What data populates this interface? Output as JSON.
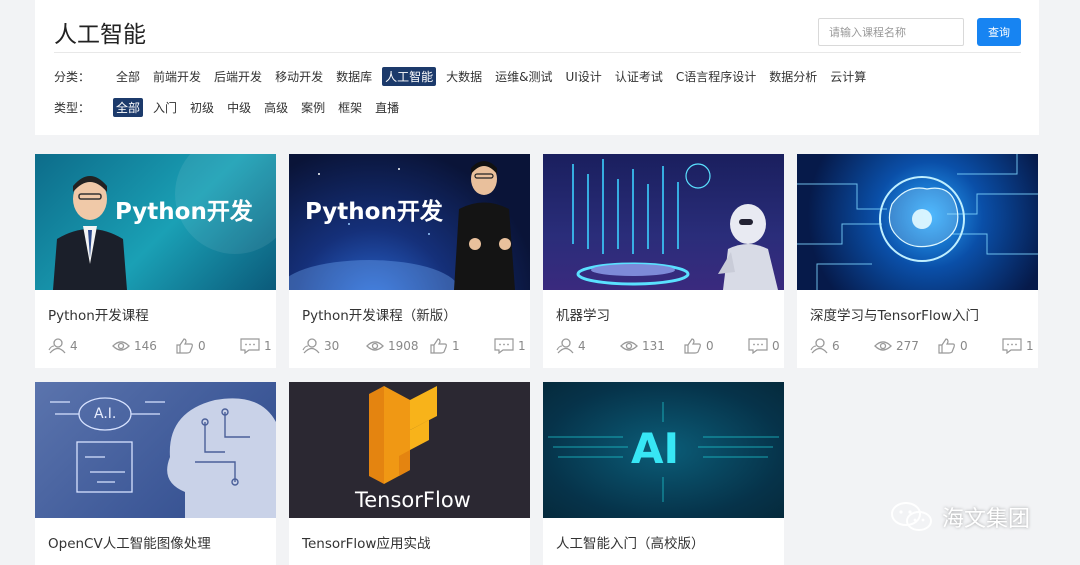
{
  "header": {
    "title": "人工智能",
    "search_placeholder": "请输入课程名称",
    "search_button": "查询"
  },
  "filters": {
    "category_label": "分类：",
    "categories": [
      "全部",
      "前端开发",
      "后端开发",
      "移动开发",
      "数据库",
      "人工智能",
      "大数据",
      "运维&测试",
      "UI设计",
      "认证考试",
      "C语言程序设计",
      "数据分析",
      "云计算"
    ],
    "category_active": "人工智能",
    "type_label": "类型：",
    "types": [
      "全部",
      "入门",
      "初级",
      "中级",
      "高级",
      "案例",
      "框架",
      "直播"
    ],
    "type_active": "全部"
  },
  "courses": [
    {
      "title": "Python开发课程",
      "students": "4",
      "views": "146",
      "likes": "0",
      "comments": "1",
      "thumb_text": "Python开发",
      "thumb_theme": "python-1"
    },
    {
      "title": "Python开发课程（新版）",
      "students": "30",
      "views": "1908",
      "likes": "1",
      "comments": "1",
      "thumb_text": "Python开发",
      "thumb_theme": "python-2"
    },
    {
      "title": "机器学习",
      "students": "4",
      "views": "131",
      "likes": "0",
      "comments": "0",
      "thumb_text": "",
      "thumb_theme": "ml"
    },
    {
      "title": "深度学习与TensorFlow入门",
      "students": "6",
      "views": "277",
      "likes": "0",
      "comments": "1",
      "thumb_text": "",
      "thumb_theme": "dl"
    },
    {
      "title": "OpenCV人工智能图像处理",
      "thumb_text": "A.I.",
      "thumb_theme": "opencv"
    },
    {
      "title": "TensorFlow应用实战",
      "thumb_text": "TensorFlow",
      "thumb_theme": "tf"
    },
    {
      "title": "人工智能入门（高校版）",
      "thumb_text": "AI",
      "thumb_theme": "ai"
    }
  ],
  "watermark": "海文集团",
  "colors": {
    "accent": "#1784f2",
    "active_filter": "#1c3a6b",
    "page_bg": "#f2f3f5"
  }
}
